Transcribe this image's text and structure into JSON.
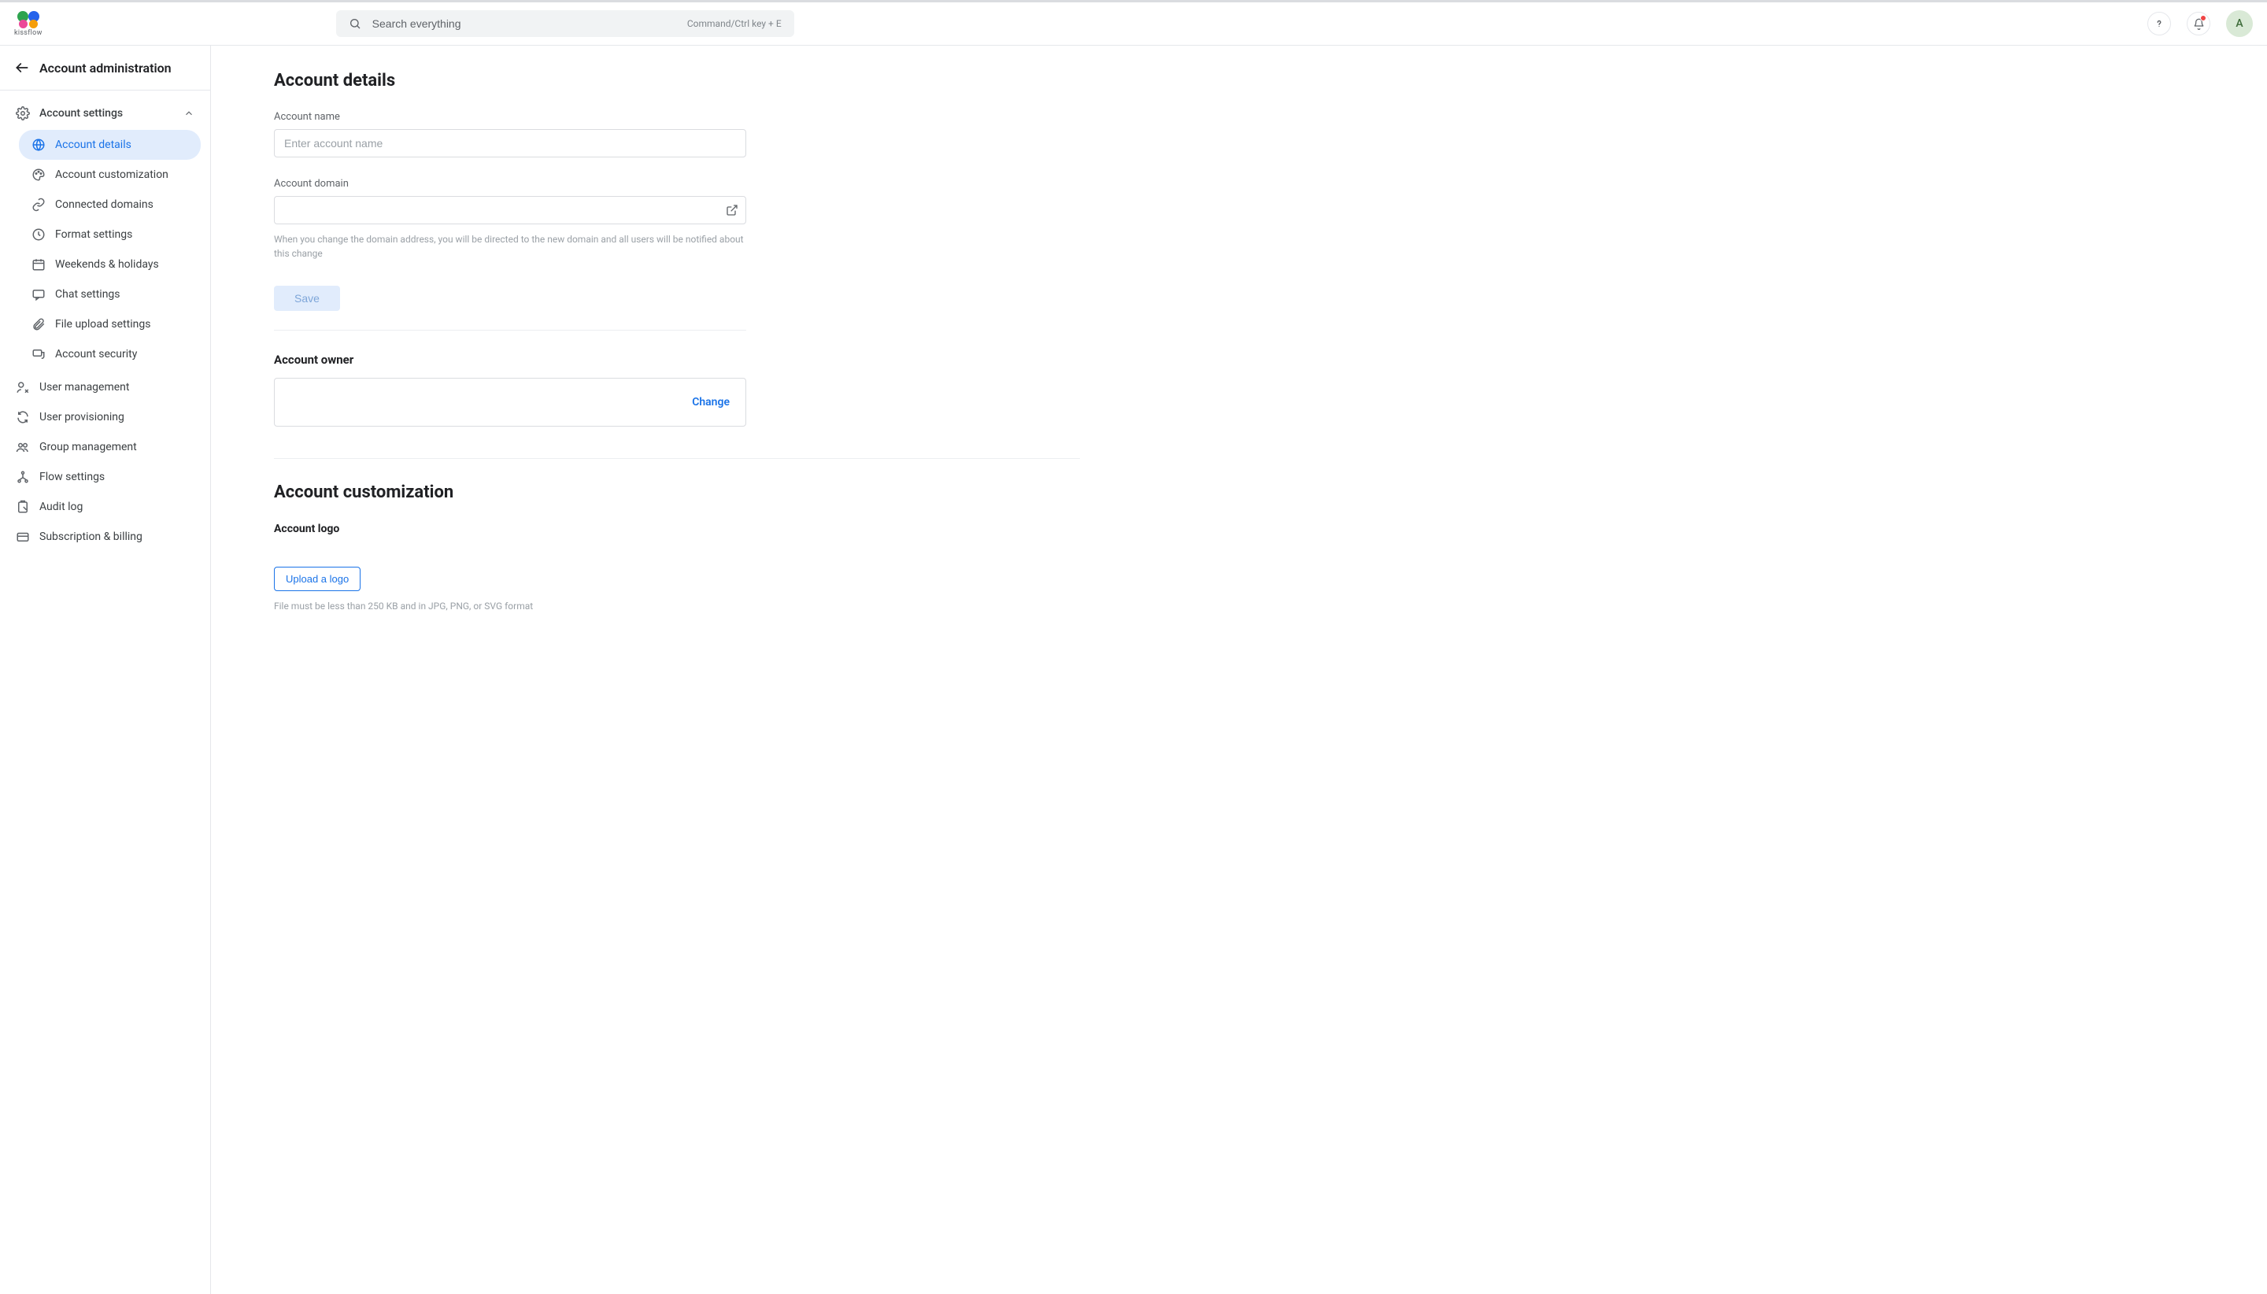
{
  "brand": {
    "name": "kissflow"
  },
  "search": {
    "placeholder": "Search everything",
    "shortcut": "Command/Ctrl key + E"
  },
  "avatar_letter": "A",
  "sidebar": {
    "header": "Account administration",
    "section_label": "Account settings",
    "items": [
      {
        "label": "Account details"
      },
      {
        "label": "Account customization"
      },
      {
        "label": "Connected domains"
      },
      {
        "label": "Format settings"
      },
      {
        "label": "Weekends & holidays"
      },
      {
        "label": "Chat settings"
      },
      {
        "label": "File upload settings"
      },
      {
        "label": "Account security"
      }
    ],
    "top_items": [
      {
        "label": "User management"
      },
      {
        "label": "User provisioning"
      },
      {
        "label": "Group management"
      },
      {
        "label": "Flow settings"
      },
      {
        "label": "Audit log"
      },
      {
        "label": "Subscription & billing"
      }
    ]
  },
  "main": {
    "details": {
      "title": "Account details",
      "name_label": "Account name",
      "name_placeholder": "Enter account name",
      "domain_label": "Account domain",
      "domain_help": "When you change the domain address, you will be directed to the new domain and all users will be notified about this change",
      "save_label": "Save",
      "owner_heading": "Account owner",
      "change_label": "Change"
    },
    "customization": {
      "title": "Account customization",
      "logo_label": "Account logo",
      "upload_label": "Upload a logo",
      "upload_help": "File must be less than 250 KB and in JPG, PNG, or SVG format"
    }
  }
}
